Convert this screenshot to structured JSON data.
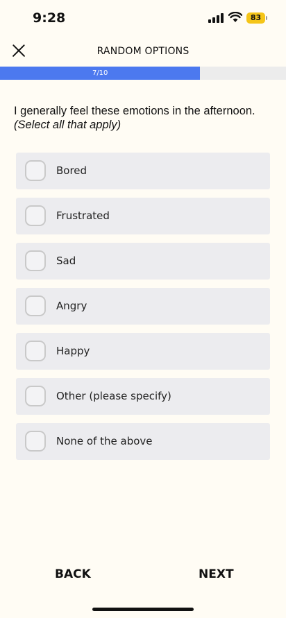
{
  "status_bar": {
    "time": "9:28",
    "battery": "83",
    "icons": [
      "signal-icon",
      "wifi-icon",
      "battery-icon"
    ]
  },
  "header": {
    "title": "RANDOM OPTIONS",
    "close_icon": "close-icon"
  },
  "progress": {
    "label": "7/10",
    "fraction": 0.7,
    "fill_color": "#4c79ef"
  },
  "question": {
    "text": "I generally feel these emotions in the afternoon.",
    "hint": "(Select all that apply)"
  },
  "options": [
    {
      "label": "Bored",
      "checked": false
    },
    {
      "label": "Frustrated",
      "checked": false
    },
    {
      "label": "Sad",
      "checked": false
    },
    {
      "label": "Angry",
      "checked": false
    },
    {
      "label": "Happy",
      "checked": false
    },
    {
      "label": "Other (please specify)",
      "checked": false
    },
    {
      "label": "None of the above",
      "checked": false
    }
  ],
  "nav": {
    "back": "BACK",
    "next": "NEXT"
  }
}
